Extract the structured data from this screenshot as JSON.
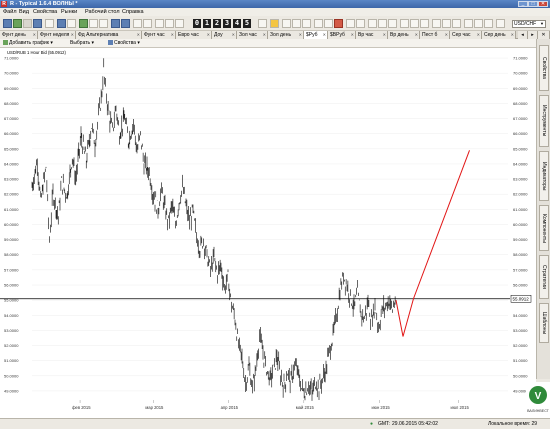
{
  "window": {
    "title": "R - Typical 1.6.4 ВОЛНЫ *",
    "app_icon_letter": "R",
    "minimize": "_",
    "maximize": "□",
    "close": "✕"
  },
  "menu": [
    "Файл",
    "Вид",
    "Свойства",
    "Рынки",
    "Рабочий стол",
    "Справка"
  ],
  "toolbar": {
    "number_buttons": [
      "0",
      "1",
      "2",
      "3",
      "4",
      "5"
    ],
    "symbol_select": "USD/CHF"
  },
  "tabs": [
    {
      "label": "Фунт день",
      "active": false
    },
    {
      "label": "Фунт неделя",
      "active": false
    },
    {
      "label": "Фд Альтернатива",
      "active": false
    },
    {
      "label": "Фунт час",
      "active": false
    },
    {
      "label": "Евро час",
      "active": false
    },
    {
      "label": "Доу",
      "active": false
    },
    {
      "label": "Зол час",
      "active": false
    },
    {
      "label": "Зол день",
      "active": false
    },
    {
      "label": "$Руб",
      "active": true
    },
    {
      "label": "$ВРуб",
      "active": false
    },
    {
      "label": "Вр час",
      "active": false
    },
    {
      "label": "Вр день",
      "active": false
    },
    {
      "label": "Пест б",
      "active": false
    },
    {
      "label": "Сер час",
      "active": false
    },
    {
      "label": "Сер день",
      "active": false
    }
  ],
  "chart_toolbar": {
    "add_graph": "Добавить график ▾",
    "select": "Выбрать ▾",
    "properties": "Свойства ▾"
  },
  "chart_data": {
    "type": "line",
    "series_label": "USD/RUB 1 Hour Bid (55.0912)",
    "y_ticks": [
      "71.0000",
      "70.0000",
      "69.0000",
      "68.0000",
      "67.0000",
      "66.0000",
      "65.0000",
      "64.0000",
      "63.0000",
      "62.0000",
      "61.0000",
      "60.0000",
      "59.0000",
      "58.0000",
      "57.0000",
      "56.0000",
      "55.0000",
      "54.0000",
      "53.0000",
      "52.0000",
      "51.0000",
      "50.0000",
      "49.0000"
    ],
    "ylim": [
      48.4,
      71.4
    ],
    "x_ticks": [
      "фев 2015",
      "мар 2015",
      "апр 2015",
      "май 2015",
      "июн 2015",
      "июл 2015"
    ],
    "current_price": 55.0912,
    "current_price_label": "55.0912",
    "price_series": [
      [
        0,
        62.5
      ],
      [
        3,
        64.2
      ],
      [
        5,
        61.5
      ],
      [
        8,
        63.8
      ],
      [
        10,
        59.0
      ],
      [
        12,
        62.1
      ],
      [
        15,
        60.5
      ],
      [
        17,
        62.8
      ],
      [
        20,
        61.9
      ],
      [
        23,
        64.5
      ],
      [
        25,
        63.0
      ],
      [
        28,
        65.8
      ],
      [
        31,
        64.2
      ],
      [
        34,
        66.5
      ],
      [
        36,
        65.3
      ],
      [
        38,
        67.1
      ],
      [
        40,
        68.8
      ],
      [
        41,
        70.3
      ],
      [
        42,
        68.9
      ],
      [
        44,
        67.2
      ],
      [
        46,
        66.2
      ],
      [
        48,
        67.8
      ],
      [
        50,
        66.0
      ],
      [
        53,
        67.1
      ],
      [
        55,
        65.5
      ],
      [
        58,
        66.7
      ],
      [
        60,
        64.8
      ],
      [
        62,
        65.9
      ],
      [
        64,
        64.0
      ],
      [
        67,
        63.5
      ],
      [
        69,
        62.1
      ],
      [
        72,
        61.0
      ],
      [
        74,
        62.2
      ],
      [
        76,
        61.0
      ],
      [
        78,
        60.2
      ],
      [
        80,
        61.3
      ],
      [
        82,
        60.0
      ],
      [
        84,
        61.5
      ],
      [
        86,
        62.4
      ],
      [
        88,
        61.2
      ],
      [
        90,
        60.2
      ],
      [
        92,
        60.9
      ],
      [
        94,
        59.2
      ],
      [
        96,
        58.4
      ],
      [
        98,
        59.0
      ],
      [
        100,
        57.9
      ],
      [
        102,
        57.0
      ],
      [
        104,
        57.8
      ],
      [
        106,
        56.8
      ],
      [
        108,
        57.3
      ],
      [
        110,
        55.8
      ],
      [
        112,
        56.5
      ],
      [
        114,
        54.7
      ],
      [
        116,
        53.8
      ],
      [
        118,
        52.0
      ],
      [
        120,
        51.2
      ],
      [
        122,
        49.5
      ],
      [
        124,
        50.6
      ],
      [
        126,
        49.2
      ],
      [
        128,
        50.5
      ],
      [
        130,
        52.6
      ],
      [
        132,
        51.5
      ],
      [
        134,
        50.5
      ],
      [
        136,
        49.7
      ],
      [
        138,
        50.4
      ],
      [
        140,
        51.3
      ],
      [
        142,
        50.0
      ],
      [
        144,
        49.3
      ],
      [
        146,
        50.2
      ],
      [
        148,
        49.6
      ],
      [
        150,
        50.7
      ],
      [
        152,
        50.2
      ],
      [
        154,
        49.2
      ],
      [
        156,
        48.9
      ],
      [
        158,
        49.4
      ],
      [
        160,
        48.8
      ],
      [
        162,
        49.6
      ],
      [
        164,
        49.2
      ],
      [
        166,
        49.8
      ],
      [
        168,
        50.4
      ],
      [
        170,
        51.7
      ],
      [
        172,
        52.6
      ],
      [
        174,
        54.0
      ],
      [
        176,
        55.6
      ],
      [
        178,
        56.6
      ],
      [
        180,
        56.0
      ],
      [
        182,
        55.2
      ],
      [
        184,
        54.5
      ],
      [
        186,
        55.4
      ],
      [
        188,
        54.1
      ],
      [
        190,
        53.8
      ],
      [
        192,
        54.9
      ],
      [
        194,
        53.6
      ],
      [
        196,
        54.7
      ],
      [
        198,
        53.2
      ],
      [
        200,
        54.3
      ],
      [
        202,
        54.6
      ],
      [
        204,
        55.0
      ],
      [
        206,
        54.4
      ],
      [
        208,
        55.2
      ]
    ],
    "projection": [
      [
        208,
        55.0
      ],
      [
        212,
        52.6
      ],
      [
        218,
        55.1
      ],
      [
        250,
        64.9
      ]
    ],
    "x_domain": [
      0,
      272
    ]
  },
  "side_tabs": [
    "Свойства",
    "Инструменты",
    "Индикаторы",
    "Компоненты",
    "Стратегии",
    "Шаблоны"
  ],
  "logo": {
    "text": "ВАЛИНВЕСТ",
    "symbol": "V"
  },
  "status": {
    "icon_label": "GMT:",
    "datetime": "29.06.2015 05:42:02",
    "local_time_label": "Локальное время: 29"
  },
  "colors": {
    "projection": "#e21616",
    "price": "#000000",
    "hline": "#000000",
    "logo_green": "#2f8a3a"
  }
}
